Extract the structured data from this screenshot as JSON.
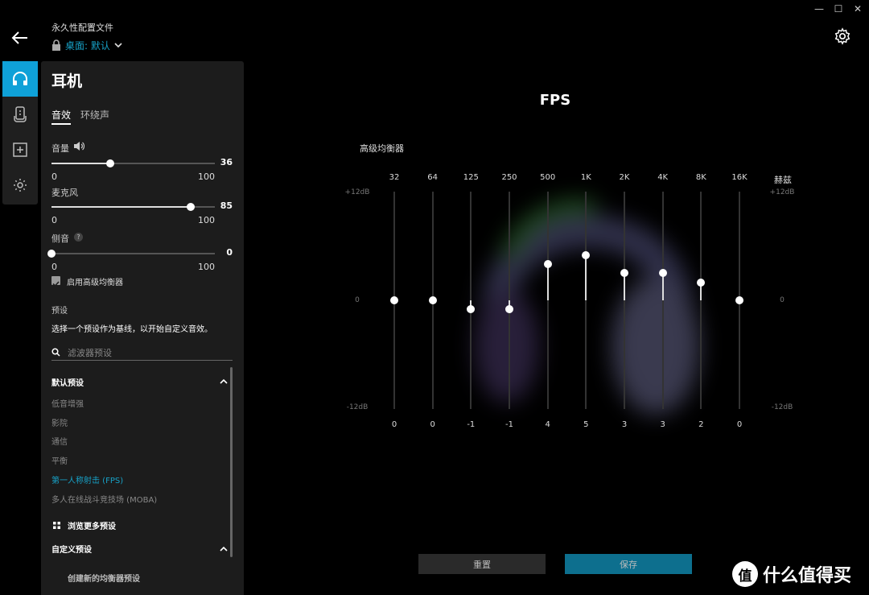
{
  "window": {
    "minimize": "—",
    "maximize": "☐",
    "close": "✕"
  },
  "profile": {
    "label": "永久性配置文件",
    "value": "桌面: 默认"
  },
  "panel": {
    "title": "耳机",
    "tabs": [
      "音效",
      "环绕声"
    ],
    "volume": {
      "label": "音量",
      "value": "36",
      "min": "0",
      "max": "100",
      "level": 36
    },
    "mic": {
      "label": "麦克风",
      "value": "85",
      "min": "0",
      "max": "100",
      "level": 85
    },
    "sidetone": {
      "label": "侧音",
      "help": "?",
      "value": "0",
      "min": "0",
      "max": "100",
      "level": 0
    },
    "advanced_eq_checkbox": "启用高级均衡器",
    "preset_heading": "预设",
    "preset_desc": "选择一个预设作为基线，以开始自定义音效。",
    "search_placeholder": "滤波器预设",
    "default_presets_title": "默认预设",
    "default_presets": [
      "低音增强",
      "影院",
      "通信",
      "平衡",
      "第一人称射击 (FPS)",
      "多人在线战斗竞技场 (MOBA)"
    ],
    "selected_preset": "第一人称射击 (FPS)",
    "browse_more": "浏览更多预设",
    "custom_presets_title": "自定义预设",
    "create_new": "创建新的均衡器预设"
  },
  "main": {
    "preset_name": "FPS",
    "eq_label": "高级均衡器",
    "unit_label": "赫兹",
    "db_top": "+12dB",
    "db_mid": "0",
    "db_bottom": "-12dB",
    "reset": "重置",
    "save": "保存"
  },
  "chart_data": {
    "type": "bar",
    "categories": [
      "32",
      "64",
      "125",
      "250",
      "500",
      "1K",
      "2K",
      "4K",
      "8K",
      "16K"
    ],
    "values": [
      0,
      0,
      -1,
      -1,
      4,
      5,
      3,
      3,
      2,
      0
    ],
    "value_labels": [
      "0",
      "0",
      "-1",
      "-1",
      "4",
      "5",
      "3",
      "3",
      "2",
      "0"
    ],
    "ylim": [
      -12,
      12
    ]
  },
  "watermark": {
    "text": "什么值得买",
    "logo": "值"
  },
  "colors": {
    "accent": "#0fa1d8",
    "selected_text": "#17a2c8",
    "save_button": "#0d6f8e"
  }
}
